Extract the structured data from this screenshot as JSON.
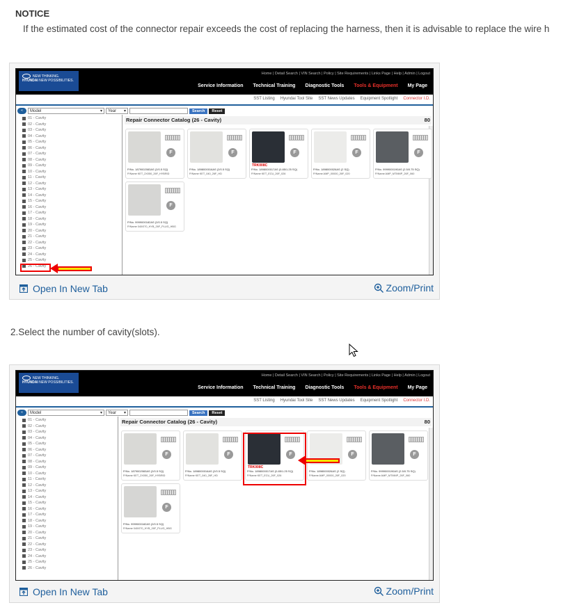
{
  "notice": {
    "title": "NOTICE",
    "text": "If the estimated cost of the connector repair exceeds the cost of replacing the harness, then it is advisable to replace the wire h"
  },
  "step2": "2.Select the number of cavity(slots).",
  "screenshot": {
    "logo_brand": "HYUNDAI",
    "logo_tagline_1": "NEW THINKING.",
    "logo_tagline_2": "NEW POSSIBILITIES.",
    "top_links": "Home | Detail Search | VIN Search | Policy | Site Requirements | Links Page | Help | Admin | Logout",
    "main_nav": [
      "Service Information",
      "Technical Training",
      "Diagnostic Tools",
      "Tools & Equipment",
      "My Page"
    ],
    "sub_nav": [
      "SST Listing",
      "Hyundai Tool Site",
      "SST News Updates",
      "Equipment Spotlight",
      "Connector I.D."
    ],
    "model_label": "Model",
    "year_label": "Year",
    "search_label": "Search",
    "reset_label": "Reset",
    "tree_items": [
      "01 - Cavity",
      "02 - Cavity",
      "03 - Cavity",
      "04 - Cavity",
      "05 - Cavity",
      "06 - Cavity",
      "07 - Cavity",
      "08 - Cavity",
      "09 - Cavity",
      "10 - Cavity",
      "11 - Cavity",
      "12 - Cavity",
      "13 - Cavity",
      "14 - Cavity",
      "15 - Cavity",
      "16 - Cavity",
      "17 - Cavity",
      "18 - Cavity",
      "19 - Cavity",
      "20 - Cavity",
      "21 - Cavity",
      "22 - Cavity",
      "23 - Cavity",
      "24 - Cavity",
      "25 - Cavity",
      "26 - Cavity"
    ],
    "catalog_title": "Repair Connector Catalog (26 - Cavity)",
    "catalog_count": "80",
    "f_badge": "F",
    "cards": [
      {
        "pno": "P/No.   1879002083AS      (2/0.5 SQ)",
        "pname": "P/Name  KET_2X050_26F_HYBRID",
        "tag": "",
        "img_color": "#d9d9d6"
      },
      {
        "pno": "P/No.   1898000016AS      (2/0.5 SQ)",
        "pname": "P/Name  KET_040_26F_HD",
        "tag": "",
        "img_color": "#e2e2df"
      },
      {
        "pno": "P/No.   1898000017AS   (0.85/1.25 SQ)",
        "pname": "P/Name  KET_ECU_26F_026",
        "tag": "TRK008C",
        "img_color": "#2a2f36"
      },
      {
        "pno": "P/No.   1898000026AS        (2 SQ)",
        "pname": "P/Name  AMP_00000_26F_020",
        "tag": "",
        "img_color": "#ececea"
      },
      {
        "pno": "P/No.   9999000190AS    (2.5/0.75 SQ)",
        "pname": "P/Name  AMP_MTMMP_26F_060",
        "tag": "",
        "img_color": "#5a5e62"
      },
      {
        "pno": "P/No.   9999000182AS      (2/0.5 SQ)",
        "pname": "P/Name  040/070_HYB_26F_PLUG_HBG",
        "tag": "",
        "img_color": "#d6d6d4"
      }
    ]
  },
  "footer": {
    "open_tab": "Open In New Tab",
    "zoom": "Zoom/Print"
  },
  "colors": {
    "link": "#1f5f9c",
    "highlight": "#e00000",
    "arrow_fill": "#f6e600",
    "active_nav": "#e8302a"
  }
}
